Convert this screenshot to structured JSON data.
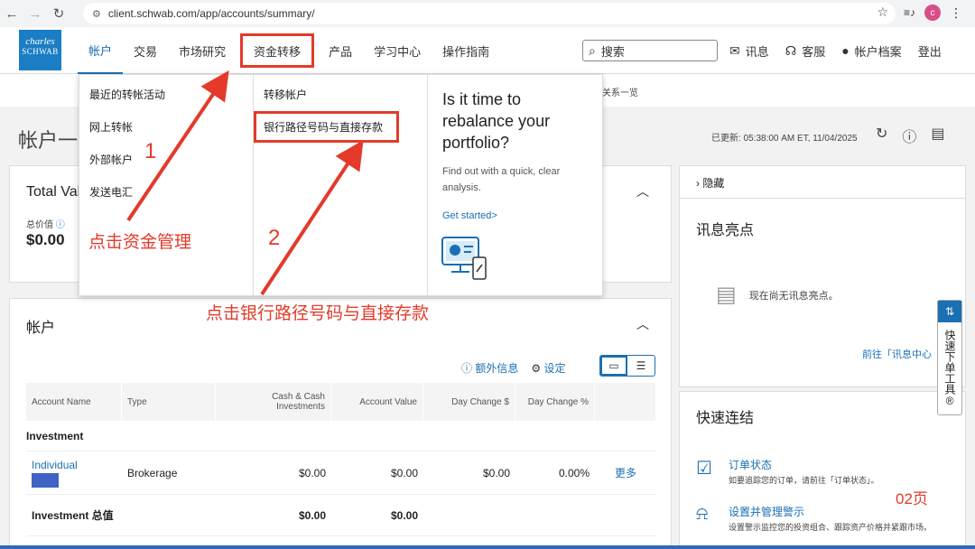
{
  "browser": {
    "url": "client.schwab.com/app/accounts/summary/",
    "profile_initial": "c"
  },
  "logo": {
    "line1": "charles",
    "line2": "SCHWAB"
  },
  "nav": {
    "items": [
      "帐户",
      "交易",
      "市场研究",
      "资金转移",
      "产品",
      "学习中心",
      "操作指南"
    ]
  },
  "header": {
    "search_placeholder": "搜索",
    "messages": "讯息",
    "service": "客服",
    "profile": "帐户档案",
    "logout": "登出"
  },
  "subbar": {
    "partial_link": "关系一览"
  },
  "page": {
    "title": "帐户一览",
    "updated": "已更新: 05:38:00 AM ET, 11/04/2025"
  },
  "total_value": {
    "title": "Total Value",
    "label": "总价值",
    "value": "$0.00"
  },
  "accounts": {
    "title": "帐户",
    "extra_info": "额外信息",
    "settings": "设定",
    "columns": [
      "Account Name",
      "Type",
      "Cash & Cash Investments",
      "Account Value",
      "Day Change $",
      "Day Change %"
    ],
    "group": "Investment",
    "row": {
      "name": "Individual",
      "type": "Brokerage",
      "cash": "$0.00",
      "value": "$0.00",
      "day_change": "$0.00",
      "day_change_pct": "0.00%",
      "more": "更多"
    },
    "total": {
      "label": "Investment 总值",
      "cash": "$0.00",
      "value": "$0.00"
    }
  },
  "right": {
    "hide": "隐藏",
    "news_title": "讯息亮点",
    "news_empty": "现在尚无讯息亮点。",
    "news_link": "前往「讯息中心",
    "quick_links_title": "快速连结",
    "quick_links": [
      {
        "title": "订单状态",
        "desc": "如要追踪您的订单，请前往「订单状态」。"
      },
      {
        "title": "设置并管理警示",
        "desc": "设置警示监控您的投资组合、跟踪资产价格并紧跟市场。"
      }
    ],
    "side_tab": "快速下单工具®"
  },
  "dropdown": {
    "col1": [
      "最近的转帐活动",
      "网上转帐",
      "外部帐户",
      "发送电汇"
    ],
    "col2": [
      "转移帐户",
      "银行路径号码与直接存款"
    ],
    "promo_title": "Is it time to rebalance your portfolio?",
    "promo_desc": "Find out with a quick, clear analysis.",
    "promo_link": "Get started>"
  },
  "annotations": {
    "num1": "1",
    "num2": "2",
    "step1": "点击资金管理",
    "step2": "点击银行路径号码与直接存款",
    "page_marker": "02页"
  },
  "colors": {
    "brand": "#1b6fb3",
    "annotation": "#e33a2a"
  }
}
